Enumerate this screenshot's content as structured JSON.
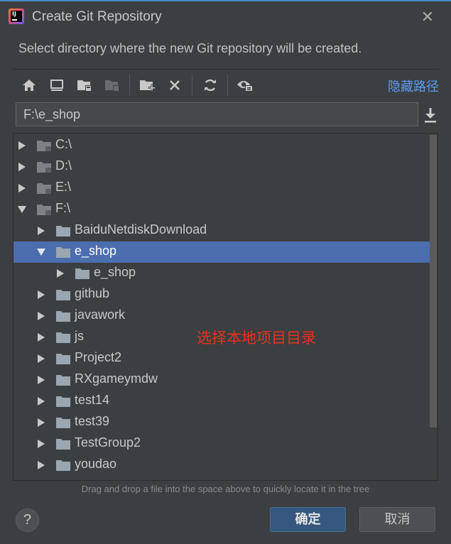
{
  "window": {
    "title": "Create Git Repository",
    "close_icon": "close-icon"
  },
  "description": "Select directory where the new Git repository will be created.",
  "toolbar": {
    "icons": [
      "home-icon",
      "desktop-icon",
      "project-folder-icon",
      "module-folder-icon",
      "new-folder-icon",
      "delete-icon",
      "refresh-icon",
      "show-hidden-icon"
    ],
    "hide_path_label": "隐藏路径"
  },
  "path": {
    "value": "F:\\e_shop"
  },
  "tree": {
    "items": [
      {
        "label": "C:\\",
        "level": 0,
        "expanded": false,
        "type": "drive"
      },
      {
        "label": "D:\\",
        "level": 0,
        "expanded": false,
        "type": "drive"
      },
      {
        "label": "E:\\",
        "level": 0,
        "expanded": false,
        "type": "drive"
      },
      {
        "label": "F:\\",
        "level": 0,
        "expanded": true,
        "type": "drive"
      },
      {
        "label": "BaiduNetdiskDownload",
        "level": 1,
        "expanded": false,
        "type": "folder"
      },
      {
        "label": "e_shop",
        "level": 1,
        "expanded": true,
        "type": "folder",
        "selected": true
      },
      {
        "label": "e_shop",
        "level": 2,
        "expanded": false,
        "type": "folder"
      },
      {
        "label": "github",
        "level": 1,
        "expanded": false,
        "type": "folder"
      },
      {
        "label": "javawork",
        "level": 1,
        "expanded": false,
        "type": "folder"
      },
      {
        "label": "js",
        "level": 1,
        "expanded": false,
        "type": "folder"
      },
      {
        "label": "Project2",
        "level": 1,
        "expanded": false,
        "type": "folder"
      },
      {
        "label": "RXgameymdw",
        "level": 1,
        "expanded": false,
        "type": "folder"
      },
      {
        "label": "test14",
        "level": 1,
        "expanded": false,
        "type": "folder"
      },
      {
        "label": "test39",
        "level": 1,
        "expanded": false,
        "type": "folder"
      },
      {
        "label": "TestGroup2",
        "level": 1,
        "expanded": false,
        "type": "folder"
      },
      {
        "label": "youdao",
        "level": 1,
        "expanded": false,
        "type": "folder"
      }
    ]
  },
  "annotation": "选择本地项目目录",
  "hint": "Drag and drop a file into the space above to quickly locate it in the tree",
  "buttons": {
    "help": "?",
    "ok": "确定",
    "cancel": "取消"
  },
  "colors": {
    "background": "#3c3f41",
    "selection": "#4b6eaf",
    "accent_link": "#589df6",
    "annotation": "#e8301e",
    "ok_button": "#365880"
  }
}
